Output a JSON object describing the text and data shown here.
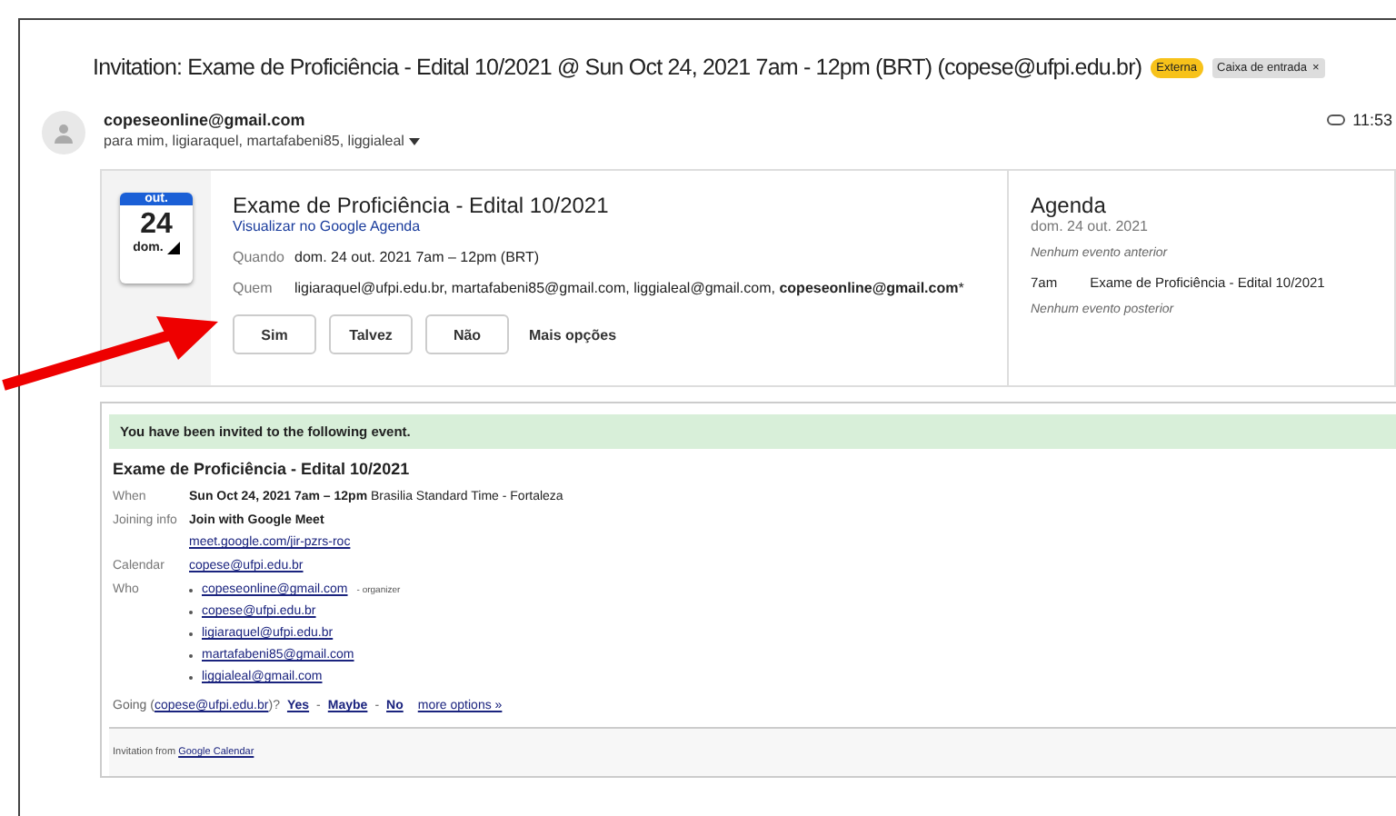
{
  "subject": {
    "title": "Invitation: Exame de Proficiência - Edital 10/2021 @ Sun Oct 24, 2021 7am - 12pm (BRT) (copese@ufpi.edu.br)",
    "labels": [
      {
        "text": "Externa",
        "kind": "warning"
      },
      {
        "text": "Caixa de entrada",
        "kind": "folder",
        "close": "×"
      }
    ]
  },
  "sender": {
    "email": "copeseonline@gmail.com",
    "recipients": "para mim, ligiaraquel, martafabeni85, liggialeal",
    "time": "11:53"
  },
  "card": {
    "calendar": {
      "month": "out.",
      "day": "24",
      "weekday": "dom."
    },
    "title": "Exame de Proficiência - Edital 10/2021",
    "link": "Visualizar no Google Agenda",
    "details": [
      {
        "label": "Quando",
        "value": "dom. 24 out. 2021 7am – 12pm (BRT)"
      },
      {
        "label": "Quem",
        "value": "ligiaraquel@ufpi.edu.br, martafabeni85@gmail.com, liggialeal@gmail.com, **copeseonline@gmail.com***"
      }
    ],
    "buttons": [
      "Sim",
      "Talvez",
      "Não"
    ],
    "more": "Mais opções"
  },
  "agenda": {
    "title": "Agenda",
    "date": "dom. 24 out. 2021",
    "before": "Nenhum evento anterior",
    "events": [
      {
        "time": "7am",
        "title": "Exame de Proficiência - Edital 10/2021"
      }
    ],
    "after": "Nenhum evento posterior"
  },
  "invite": {
    "banner": "You have been invited to the following event.",
    "title": "Exame de Proficiência - Edital 10/2021",
    "rows": [
      {
        "label": "When",
        "kind": "text",
        "lines": [
          "**Sun Oct 24, 2021 7am – 12pm** Brasilia Standard Time - Fortaleza"
        ]
      },
      {
        "label": "Joining info",
        "kind": "meet",
        "lines": [
          "Join with Google Meet",
          "meet.google.com/jir-pzrs-roc"
        ]
      },
      {
        "label": "Calendar",
        "kind": "link",
        "lines": [
          "copese@ufpi.edu.br"
        ]
      },
      {
        "label": "Who",
        "kind": "list",
        "items": [
          {
            "email": "copeseonline@gmail.com",
            "note": "- organizer"
          },
          {
            "email": "copese@ufpi.edu.br"
          },
          {
            "email": "ligiaraquel@ufpi.edu.br"
          },
          {
            "email": "martafabeni85@gmail.com"
          },
          {
            "email": "liggialeal@gmail.com"
          }
        ]
      }
    ],
    "going": {
      "prefix": "Going (",
      "calendar": "copese@ufpi.edu.br",
      "suffix": ")?",
      "options": [
        "Yes",
        "Maybe",
        "No"
      ],
      "separator": "-",
      "more": "more options »"
    },
    "footer": {
      "prefix": "Invitation from",
      "link": "Google Calendar"
    }
  }
}
